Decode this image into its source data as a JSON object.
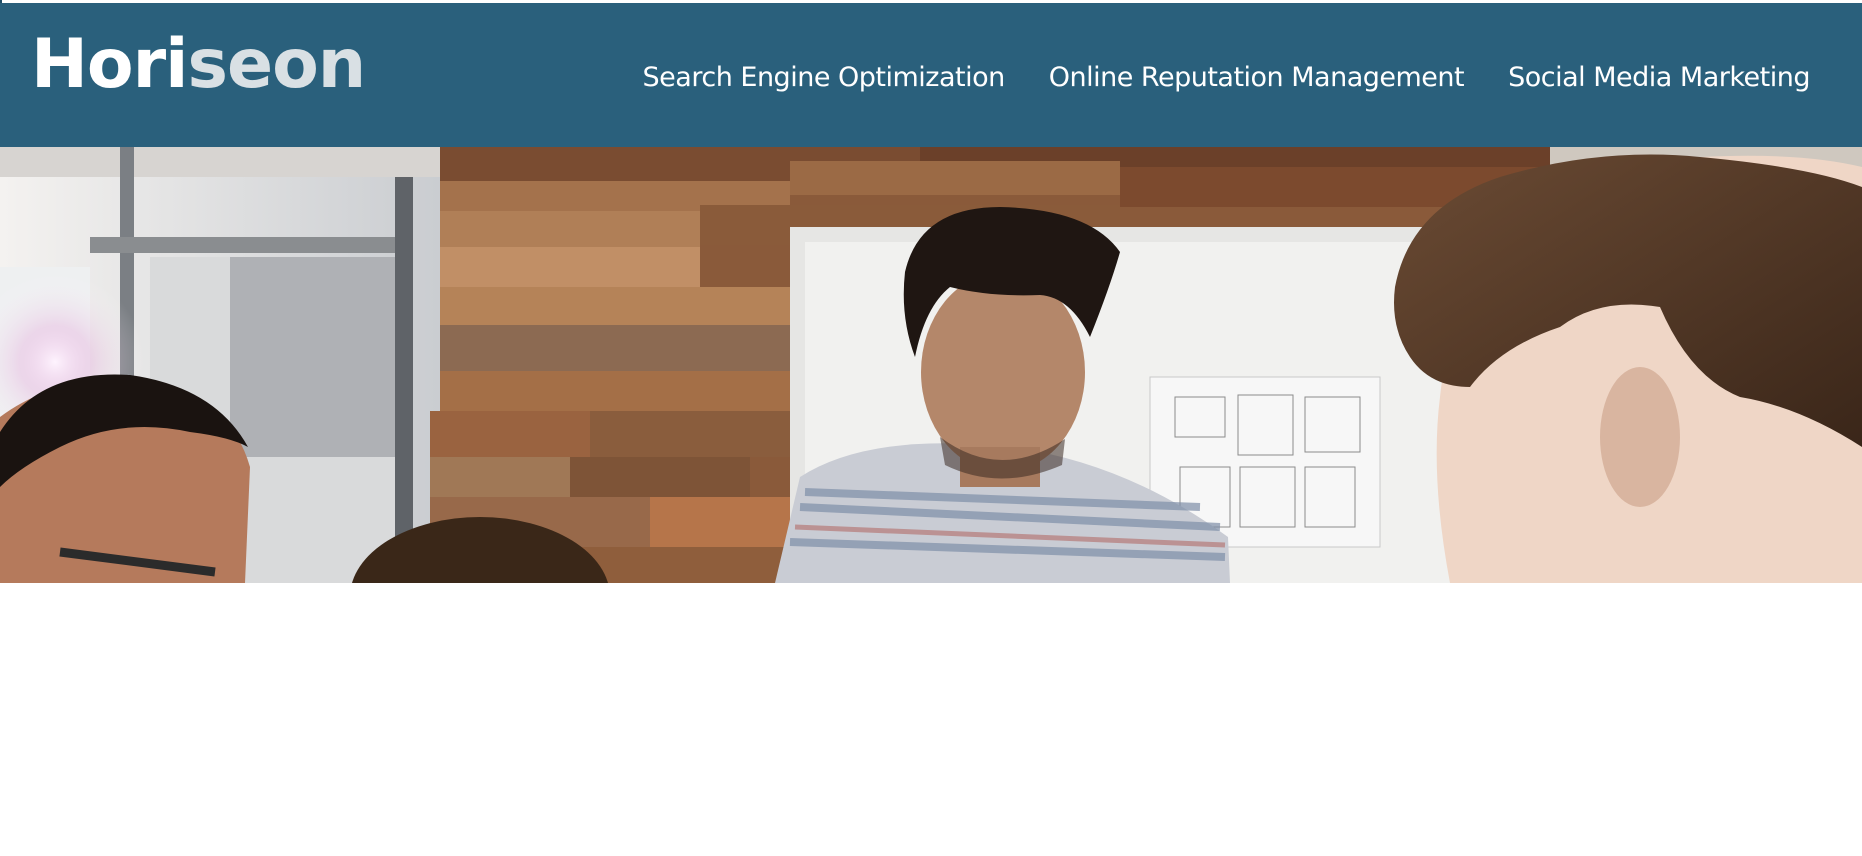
{
  "header": {
    "logo": {
      "part1": "Hori",
      "part2": "seon"
    },
    "nav": [
      {
        "label": "Search Engine Optimization"
      },
      {
        "label": "Online Reputation Management"
      },
      {
        "label": "Social Media Marketing"
      }
    ]
  },
  "colors": {
    "header_bg": "#2a607c",
    "nav_text": "#ffffff",
    "logo_light": "#d9e0e4"
  },
  "hero": {
    "image": "office-team-meeting-photo"
  }
}
